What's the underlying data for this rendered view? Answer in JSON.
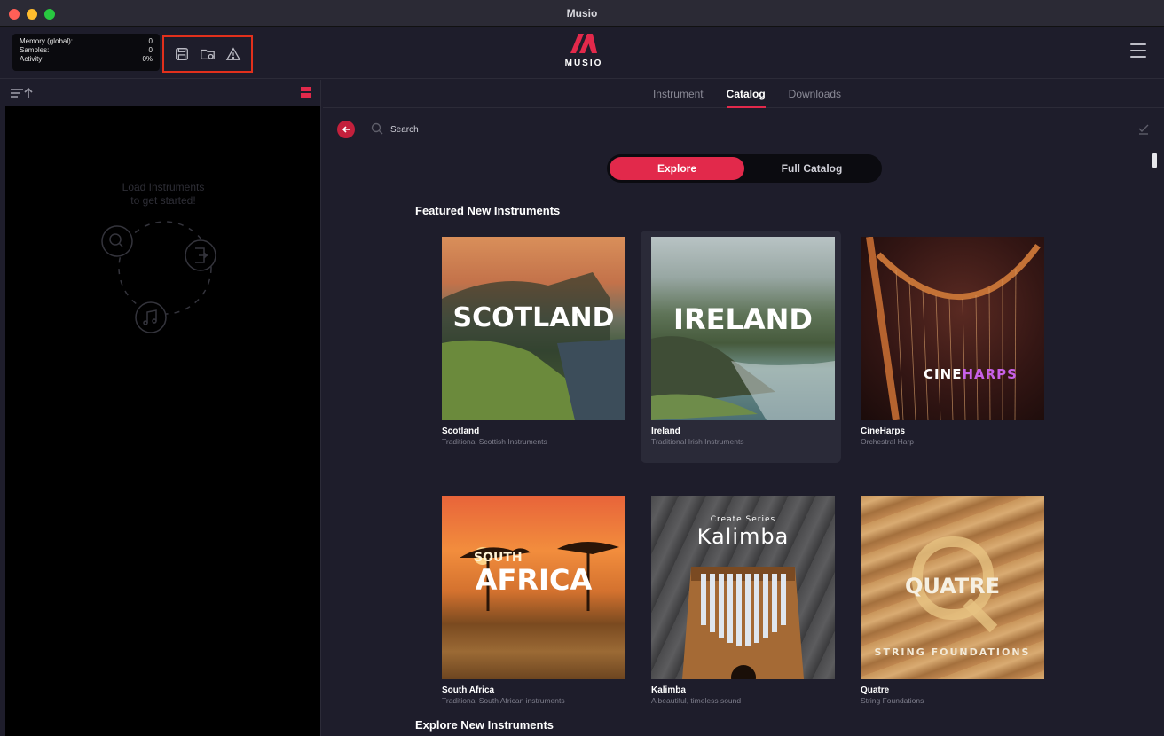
{
  "window": {
    "title": "Musio"
  },
  "colors": {
    "accent": "#e2294b",
    "highlight_box": "#e2301c",
    "background": "#1e1d2b"
  },
  "stats": [
    {
      "label": "Memory (global):",
      "value": "0"
    },
    {
      "label": "Samples:",
      "value": "0"
    },
    {
      "label": "Activity:",
      "value": "0%"
    }
  ],
  "toolbar_icons": [
    "save-icon",
    "folder-icon",
    "warning-icon"
  ],
  "logo": {
    "text": "MUSIO"
  },
  "left_panel": {
    "empty_line1": "Load Instruments",
    "empty_line2": "to get started!"
  },
  "tabs": [
    {
      "label": "Instrument"
    },
    {
      "label": "Catalog",
      "active": true
    },
    {
      "label": "Downloads"
    }
  ],
  "search": {
    "placeholder": "Search"
  },
  "segment": {
    "explore": "Explore",
    "full_catalog": "Full Catalog",
    "active": "explore"
  },
  "sections": {
    "featured": "Featured New Instruments",
    "explore_new": "Explore New Instruments"
  },
  "cards": [
    {
      "title": "Scotland",
      "subtitle": "Traditional Scottish Instruments",
      "art_text": "SCOTLAND"
    },
    {
      "title": "Ireland",
      "subtitle": "Traditional Irish Instruments",
      "art_text": "IRELAND"
    },
    {
      "title": "CineHarps",
      "subtitle": "Orchestral Harp",
      "art_text_a": "CINE",
      "art_text_b": "HARPS"
    },
    {
      "title": "South Africa",
      "subtitle": "Traditional South African instruments",
      "art_text_a": "SOUTH",
      "art_text_b": "AFRICA"
    },
    {
      "title": "Kalimba",
      "subtitle": "A beautiful, timeless sound",
      "art_text_a": "Create Series",
      "art_text_b": "Kalimba"
    },
    {
      "title": "Quatre",
      "subtitle": "String Foundations",
      "art_text_a": "QUATRE",
      "art_text_b": "STRING FOUNDATIONS"
    }
  ]
}
